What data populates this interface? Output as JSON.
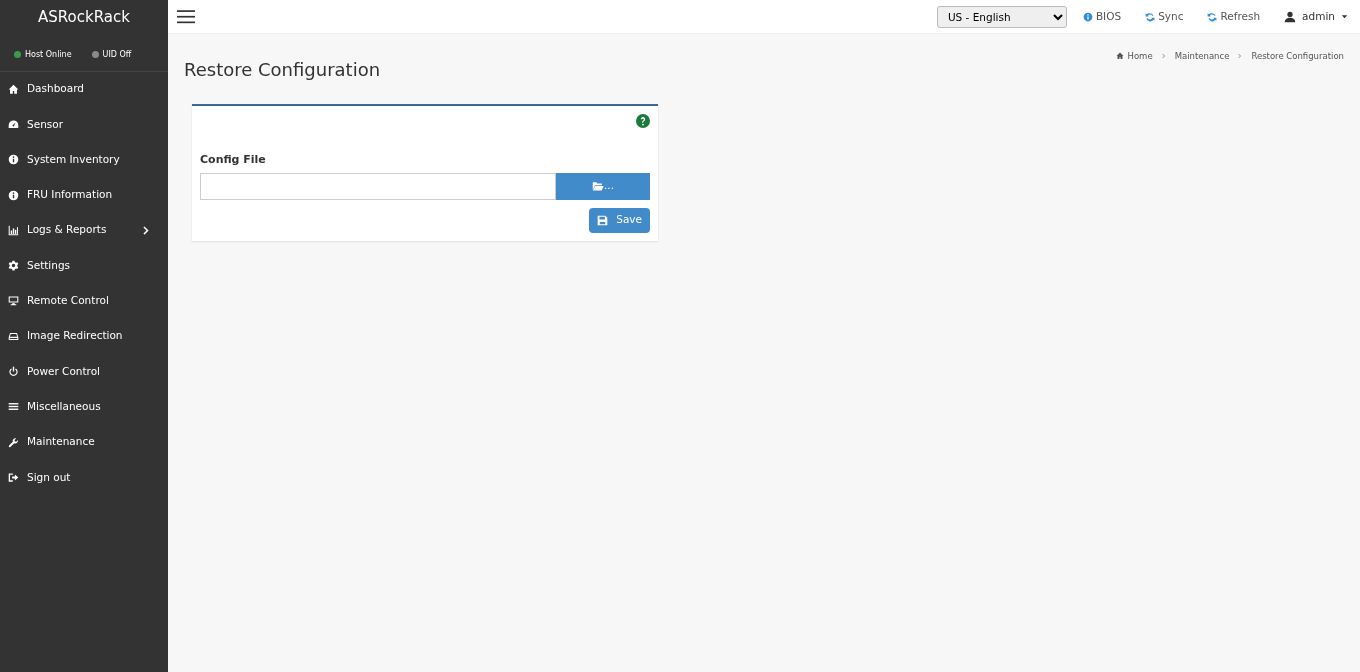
{
  "brand": "ASRockRack",
  "status": [
    {
      "label": "Host Online",
      "color": "#3c9a4a"
    },
    {
      "label": "UID Off",
      "color": "#8a8a8a"
    }
  ],
  "sidebar": {
    "items": [
      {
        "label": "Dashboard",
        "kind": "home"
      },
      {
        "label": "Sensor",
        "kind": "gauge"
      },
      {
        "label": "System Inventory",
        "kind": "info"
      },
      {
        "label": "FRU Information",
        "kind": "info"
      },
      {
        "label": "Logs & Reports",
        "kind": "chart",
        "expandable": true
      },
      {
        "label": "Settings",
        "kind": "gear"
      },
      {
        "label": "Remote Control",
        "kind": "monitor"
      },
      {
        "label": "Image Redirection",
        "kind": "drive"
      },
      {
        "label": "Power Control",
        "kind": "power"
      },
      {
        "label": "Miscellaneous",
        "kind": "bars"
      },
      {
        "label": "Maintenance",
        "kind": "wrench"
      },
      {
        "label": "Sign out",
        "kind": "signout"
      }
    ]
  },
  "topbar": {
    "language": "US - English",
    "links": [
      {
        "label": "BIOS",
        "kind": "info"
      },
      {
        "label": "Sync",
        "kind": "sync"
      },
      {
        "label": "Refresh",
        "kind": "refresh"
      }
    ],
    "user": "admin"
  },
  "page": {
    "title": "Restore Configuration",
    "breadcrumb": [
      "Home",
      "Maintenance",
      "Restore Configuration"
    ]
  },
  "form": {
    "field_label": "Config File",
    "browse_label": "...",
    "save_label": "Save"
  }
}
